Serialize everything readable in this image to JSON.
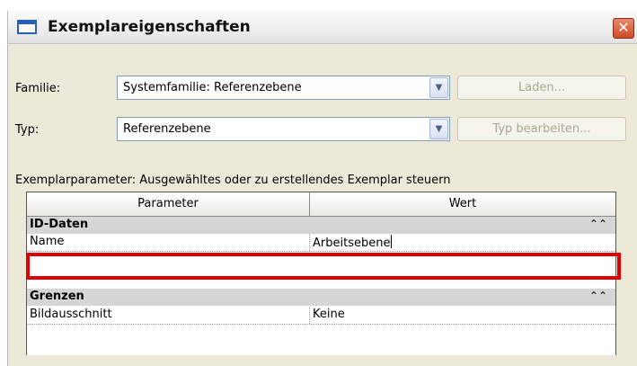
{
  "dialog": {
    "title": "Exemplareigenschaften",
    "close_symbol": "✕"
  },
  "familie": {
    "label": "Familie:",
    "value": "Systemfamilie: Referenzebene",
    "button": "Laden..."
  },
  "typ": {
    "label": "Typ:",
    "value": "Referenzebene",
    "button": "Typ bearbeiten..."
  },
  "section_label": "Exemplarparameter: Ausgewähltes oder zu erstellendes Exemplar steuern",
  "table": {
    "columns": [
      "Parameter",
      "Wert"
    ],
    "groups": [
      {
        "name": "ID-Daten",
        "rows": [
          {
            "parameter": "Name",
            "value": "Arbeitsebene"
          }
        ]
      },
      {
        "name": "Grenzen",
        "rows": [
          {
            "parameter": "Bildausschnitt",
            "value": "Keine"
          }
        ]
      }
    ]
  },
  "icons": {
    "window": "dialog-window-icon",
    "close": "close-icon",
    "dropdown": "chevron-down-icon",
    "collapse": "double-chevron-up-icon"
  },
  "colors": {
    "dialog_bg": "#ece9d8",
    "group_bg": "#d6d6d6",
    "highlight": "#e10000",
    "close_bg": "#cf4b27"
  }
}
